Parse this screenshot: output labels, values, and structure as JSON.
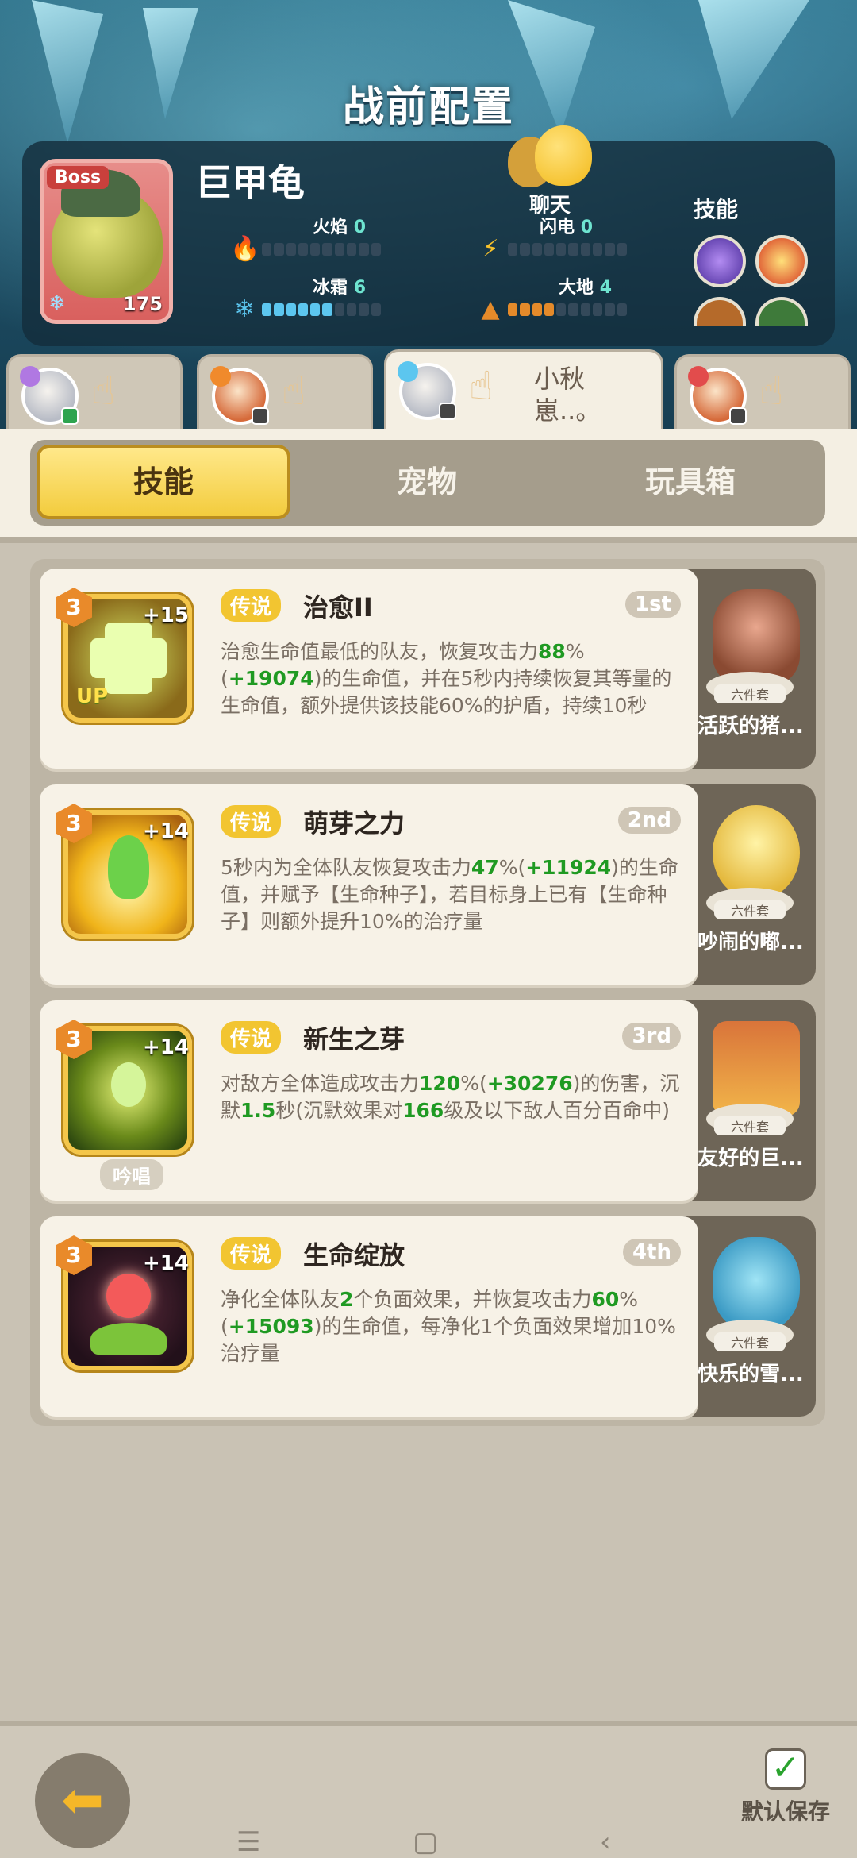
{
  "header": {
    "title": "战前配置"
  },
  "boss": {
    "tag": "Boss",
    "name": "巨甲龟",
    "level": "175",
    "chat_label": "聊天",
    "elements": [
      {
        "name": "火焰",
        "value": "0",
        "level": 0,
        "icon": "flame-icon",
        "color": "#e0372b"
      },
      {
        "name": "闪电",
        "value": "0",
        "level": 0,
        "icon": "lightning-icon",
        "color": "#f5c02b"
      },
      {
        "name": "冰霜",
        "value": "6",
        "level": 6,
        "icon": "snowflake-icon",
        "color": "#5cc6ef"
      },
      {
        "name": "大地",
        "value": "4",
        "level": 4,
        "icon": "earth-icon",
        "color": "#e48a2a"
      }
    ],
    "skills_label": "技能"
  },
  "team": [
    {
      "name": "",
      "active": false
    },
    {
      "name": "",
      "active": false
    },
    {
      "name": "小秋崽..。",
      "active": true
    },
    {
      "name": "",
      "active": false
    }
  ],
  "tabs": [
    "技能",
    "宠物",
    "玩具箱"
  ],
  "skills": [
    {
      "level": "3",
      "plus": "+15",
      "rarity": "传说",
      "title": "治愈II",
      "order": "1st",
      "desc_parts": [
        [
          "治愈生命值最低的队友，恢复攻击力",
          false
        ],
        [
          "88",
          true
        ],
        [
          "%(",
          false
        ],
        [
          "+19074",
          true
        ],
        [
          ")的生命值，并在5秒内持续恢复其等量的生命值，额外提供该技能60%的护盾，持续10秒",
          false
        ]
      ],
      "icon_label": "UP",
      "chant": "",
      "toy_set": "六件套",
      "toy_name": "活跃的猪..."
    },
    {
      "level": "3",
      "plus": "+14",
      "rarity": "传说",
      "title": "萌芽之力",
      "order": "2nd",
      "desc_parts": [
        [
          "5秒内为全体队友恢复攻击力",
          false
        ],
        [
          "47",
          true
        ],
        [
          "%(",
          false
        ],
        [
          "+11924",
          true
        ],
        [
          ")的生命值，并赋予【生命种子】，若目标身上已有【生命种子】则额外提升10%的治疗量",
          false
        ]
      ],
      "icon_label": "",
      "chant": "",
      "toy_set": "六件套",
      "toy_name": "吵闹的嘟..."
    },
    {
      "level": "3",
      "plus": "+14",
      "rarity": "传说",
      "title": "新生之芽",
      "order": "3rd",
      "desc_parts": [
        [
          "对敌方全体造成攻击力",
          false
        ],
        [
          "120",
          true
        ],
        [
          "%(",
          false
        ],
        [
          "+30276",
          true
        ],
        [
          ")的伤害，沉默",
          false
        ],
        [
          "1.5",
          true
        ],
        [
          "秒(沉默效果对",
          false
        ],
        [
          "166",
          true
        ],
        [
          "级及以下敌人百分百命中)",
          false
        ]
      ],
      "icon_label": "",
      "chant": "吟唱",
      "toy_set": "六件套",
      "toy_name": "友好的巨..."
    },
    {
      "level": "3",
      "plus": "+14",
      "rarity": "传说",
      "title": "生命绽放",
      "order": "4th",
      "desc_parts": [
        [
          "净化全体队友",
          false
        ],
        [
          "2",
          true
        ],
        [
          "个负面效果，并恢复攻击力",
          false
        ],
        [
          "60",
          true
        ],
        [
          "%(",
          false
        ],
        [
          "+15093",
          true
        ],
        [
          ")的生命值，每净化1个负面效果增加10%治疗量",
          false
        ]
      ],
      "icon_label": "",
      "chant": "",
      "toy_set": "六件套",
      "toy_name": "快乐的雪..."
    }
  ],
  "footer": {
    "save_label": "默认保存"
  }
}
